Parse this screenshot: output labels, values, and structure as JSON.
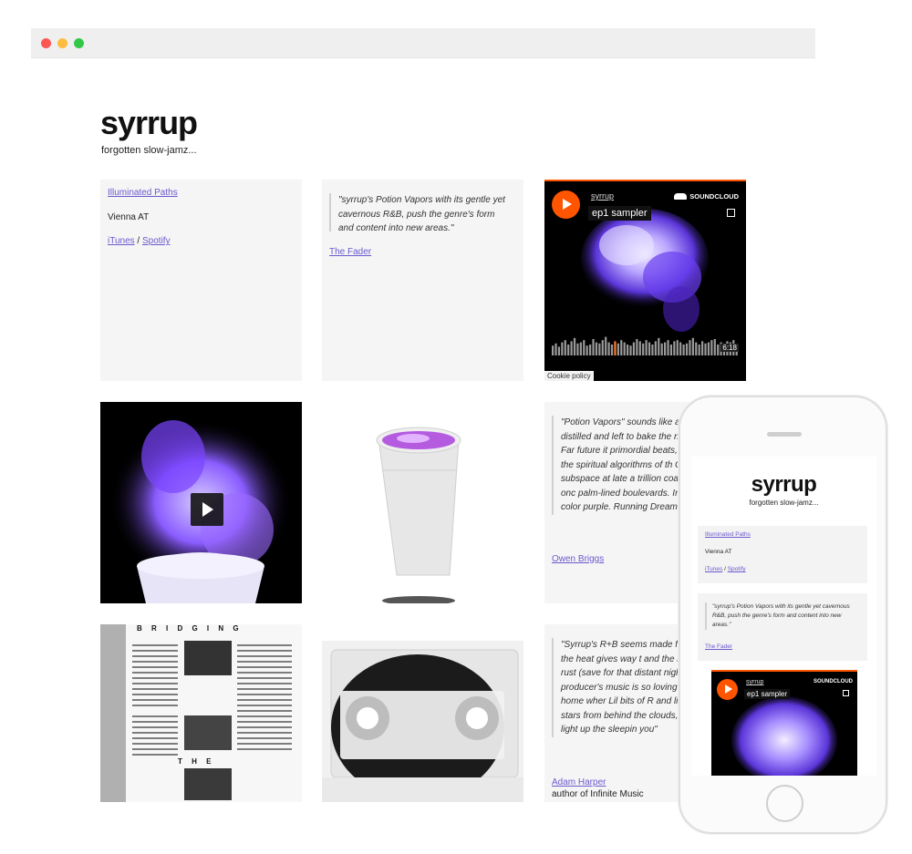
{
  "window": {
    "controls": [
      "close",
      "minimize",
      "maximize"
    ]
  },
  "site": {
    "title": "syrrup",
    "tagline": "forgotten slow-jamz..."
  },
  "info": {
    "album_link": "Illuminated Paths",
    "location": "Vienna AT",
    "itunes": "iTunes",
    "separator": " / ",
    "spotify": "Spotify"
  },
  "quote1": {
    "text": "\"syrrup's Potion Vapors with its gentle yet cavernous R&B, push the genre's form and content into new areas.\"",
    "source": "The Fader"
  },
  "soundcloud": {
    "user": "syrrup",
    "track": "ep1 sampler",
    "brand": "SOUNDCLOUD",
    "duration": "6:18",
    "cookie": "Cookie policy",
    "waveform": [
      0.45,
      0.55,
      0.4,
      0.6,
      0.7,
      0.5,
      0.65,
      0.8,
      0.55,
      0.6,
      0.7,
      0.45,
      0.5,
      0.75,
      0.6,
      0.55,
      0.7,
      0.85,
      0.6,
      0.5,
      0.65,
      0.55,
      0.7,
      0.6,
      0.5,
      0.45,
      0.6,
      0.75,
      0.65,
      0.55,
      0.7,
      0.6,
      0.5,
      0.65,
      0.8,
      0.55,
      0.6,
      0.7,
      0.5,
      0.65,
      0.7,
      0.6,
      0.5,
      0.55,
      0.7,
      0.8,
      0.6,
      0.5,
      0.65,
      0.55,
      0.6,
      0.7,
      0.75,
      0.5,
      0.6,
      0.55,
      0.65,
      0.6,
      0.7,
      0.5
    ],
    "accent": "#ff5500"
  },
  "quote2": {
    "text": "\"Potion Vapors\" sounds like aural '90s R&B distilled and left to bake the next million years. Far future it primordial beats, reconstructed i with the spiritual algorithms of th Cruising through subspace at late a trillion coastal sunsets all at onc palm-lined boulevards. Infradime hop. The color purple. Running Dreams.\"",
    "source": "Owen Briggs"
  },
  "quote3": {
    "text": "\"Syrrup's R+B seems made for the nights where the heat gives way t and the birds give way to the rust (save for that distant nightingale). Viennese producer's music is so loving it can take you home wher Lil bits of R and lil bits of B roll in stars from behind the clouds, whil drones softly light up the sleepin you\"",
    "source": "Adam Harper",
    "source_note": "author of Infinite Music"
  },
  "magazine": {
    "heading_top": "B R I D G I N G",
    "heading_mid": "T H E"
  },
  "phone": {
    "title": "syrrup",
    "tagline": "forgotten slow-jamz...",
    "album_link": "Illuminated Paths",
    "location": "Vienna AT",
    "itunes": "iTunes",
    "separator": " / ",
    "spotify": "Spotify",
    "quote": "\"syrrup's Potion Vapors with its gentle yet cavernous R&B, push the genre's form and content into new areas.\"",
    "quote_source": "The Fader",
    "sc_user": "syrrup",
    "sc_track": "ep1 sampler",
    "sc_brand": "SOUNDCLOUD"
  },
  "colors": {
    "link": "#6a5acd",
    "smoke": "#7b4dff",
    "soundcloud": "#ff5500"
  }
}
